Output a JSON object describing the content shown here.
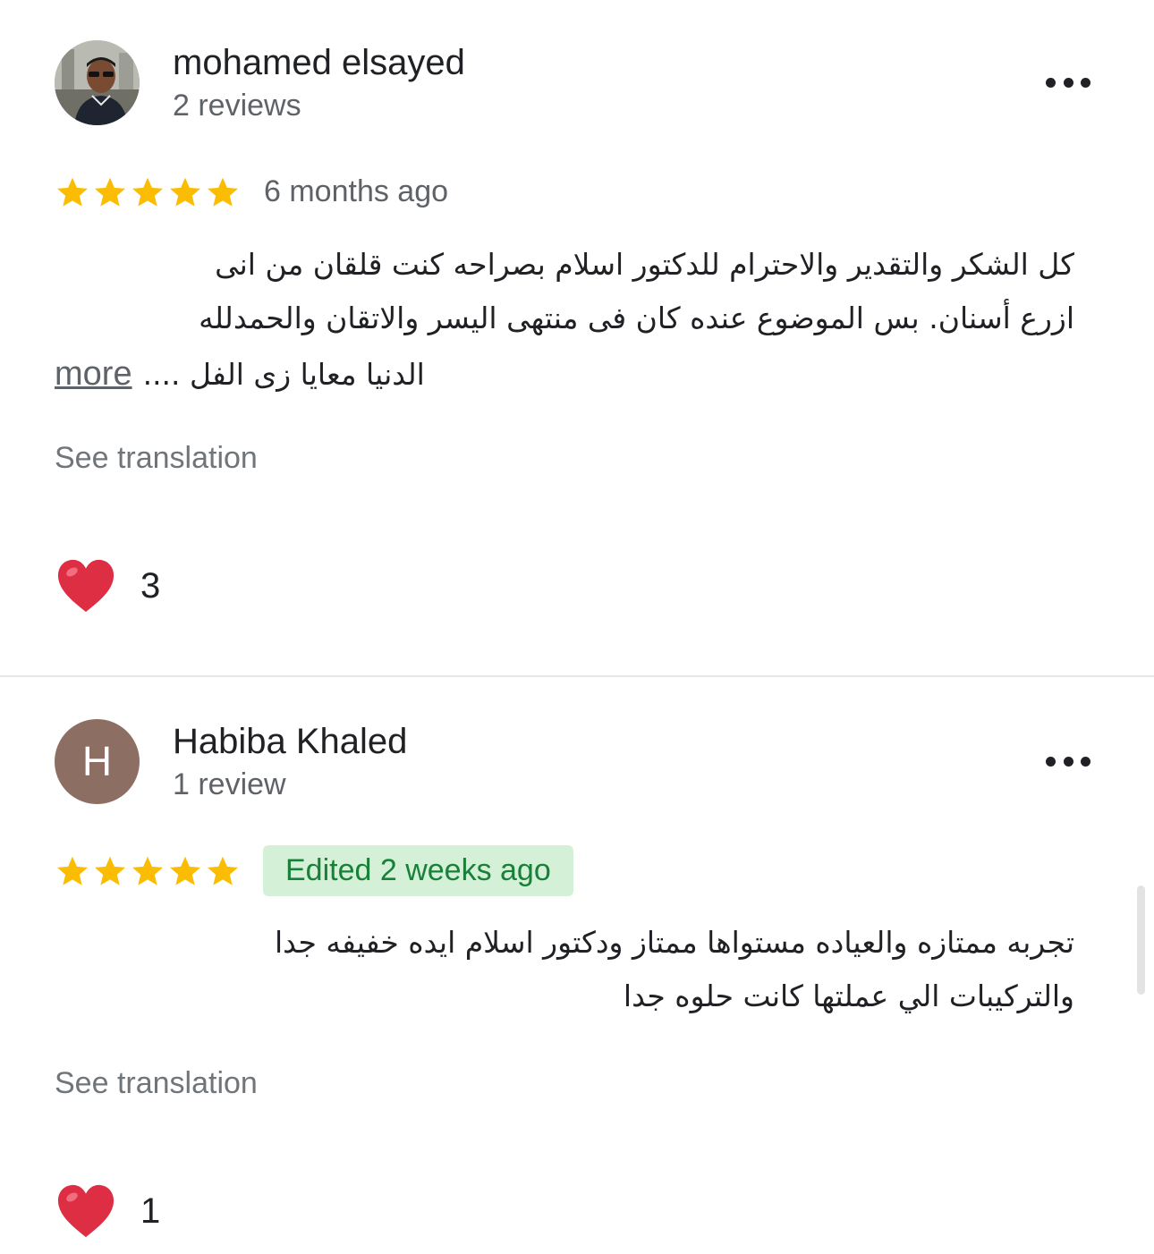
{
  "reviews": [
    {
      "author": "mohamed elsayed",
      "meta": "2 reviews",
      "avatar_letter": "",
      "rating": 5,
      "time": "6 months ago",
      "edited": false,
      "text_lines": [
        "كل الشكر والتقدير والاحترام للدكتور اسلام بصراحه كنت قلقان من انى",
        "ازرع أسنان.  بس الموضوع عنده كان فى منتهى اليسر والاتقان والحمدلله"
      ],
      "text_last_line": "الدنيا معايا زى الفل ....",
      "more_label": "more",
      "see_translation": "See translation",
      "reaction_count": "3"
    },
    {
      "author": "Habiba Khaled",
      "meta": "1 review",
      "avatar_letter": "H",
      "rating": 5,
      "time": "Edited 2 weeks ago",
      "edited": true,
      "text_lines": [
        "تجربه ممتازه والعياده مستواها ممتاز ودكتور اسلام ايده خفيفه جدا",
        "والتركيبات الي عملتها كانت حلوه جدا"
      ],
      "see_translation": "See translation",
      "reaction_count": "1"
    }
  ],
  "colors": {
    "star": "#fbbc04",
    "heart": "#dd2e44",
    "avatar_letter_bg": "#8d6e63",
    "edited_badge_bg": "#d4f1d7",
    "edited_badge_text": "#188038"
  },
  "icons": {
    "star": "star-icon",
    "heart": "heart-icon",
    "menu": "more-vert-icon"
  }
}
